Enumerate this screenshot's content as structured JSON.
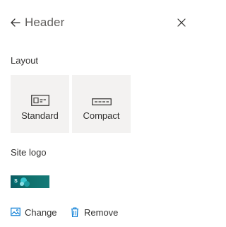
{
  "panel": {
    "title": "Header",
    "back_icon": "arrow-left-icon",
    "close_icon": "close-icon"
  },
  "layout": {
    "label": "Layout",
    "options": [
      {
        "label": "Standard",
        "icon": "standard-layout-icon"
      },
      {
        "label": "Compact",
        "icon": "compact-layout-icon"
      }
    ]
  },
  "site_logo": {
    "label": "Site logo"
  },
  "actions": {
    "change_label": "Change",
    "change_icon": "image-icon",
    "remove_label": "Remove",
    "remove_icon": "trash-icon"
  },
  "colors": {
    "accent": "#0078d4",
    "tile_bg": "#f3f2f1",
    "text": "#323130",
    "title_text": "#605e5c"
  }
}
